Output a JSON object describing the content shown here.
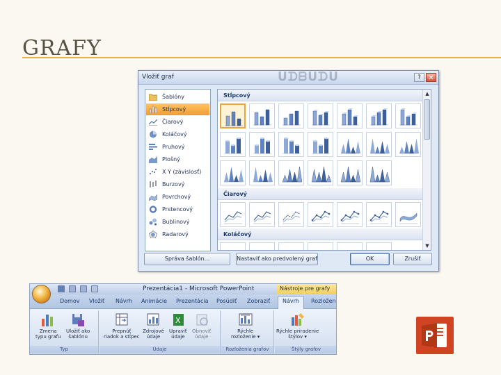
{
  "slide": {
    "title": "GRAFY"
  },
  "dialog": {
    "title": "Vložiť graf",
    "help_glyph": "?",
    "close_glyph": "×",
    "chart_types": [
      {
        "label": "Šablóny",
        "icon": "folder-icon"
      },
      {
        "label": "Stĺpcový",
        "icon": "column-chart-icon",
        "selected": true
      },
      {
        "label": "Čiarový",
        "icon": "line-chart-icon"
      },
      {
        "label": "Koláčový",
        "icon": "pie-chart-icon"
      },
      {
        "label": "Pruhový",
        "icon": "bar-chart-icon"
      },
      {
        "label": "Plošný",
        "icon": "area-chart-icon"
      },
      {
        "label": "X Y (závislosť)",
        "icon": "scatter-chart-icon"
      },
      {
        "label": "Burzový",
        "icon": "stock-chart-icon"
      },
      {
        "label": "Povrchový",
        "icon": "surface-chart-icon"
      },
      {
        "label": "Prstencový",
        "icon": "doughnut-chart-icon"
      },
      {
        "label": "Bublinový",
        "icon": "bubble-chart-icon"
      },
      {
        "label": "Radarový",
        "icon": "radar-chart-icon"
      }
    ],
    "groups": [
      {
        "label": "Stĺpcový"
      },
      {
        "label": "Čiarový"
      },
      {
        "label": "Koláčový"
      }
    ],
    "buttons": {
      "manage_templates": "Správa šablón...",
      "set_default": "Nastaviť ako predvolený graf",
      "ok": "OK",
      "cancel": "Zrušiť"
    }
  },
  "ribbon": {
    "window_title": "Prezentácia1 - Microsoft PowerPoint",
    "context_tools": "Nástroje pre grafy",
    "tabs": [
      "Domov",
      "Vložiť",
      "Návrh",
      "Animácie",
      "Prezentácia",
      "Posúdiť",
      "Zobraziť",
      "Návrh",
      "Rozložen"
    ],
    "active_tab_index": 7,
    "commands": {
      "change_type": "Zmena\ntypu grafu",
      "save_template": "Uložiť ako\nšablónu",
      "switch_row_col": "Prepnúť\nriadok a stĺpec",
      "select_data": "Zdrojové\núdaje",
      "edit_data": "Upraviť\núdaje",
      "refresh_data": "Obnoviť\núdaje",
      "quick_layout": "Rýchle\nrozloženie ▾",
      "quick_style": "Rýchle priradenie\nštýlov ▾"
    },
    "groups": {
      "type": "Typ",
      "data": "Údaje",
      "layouts": "Rozloženia grafov",
      "styles": "Štýly grafov"
    }
  },
  "colors": {
    "accent": "#e6b44a",
    "ppt_logo": "#d04423",
    "selection": "#f39a33"
  }
}
